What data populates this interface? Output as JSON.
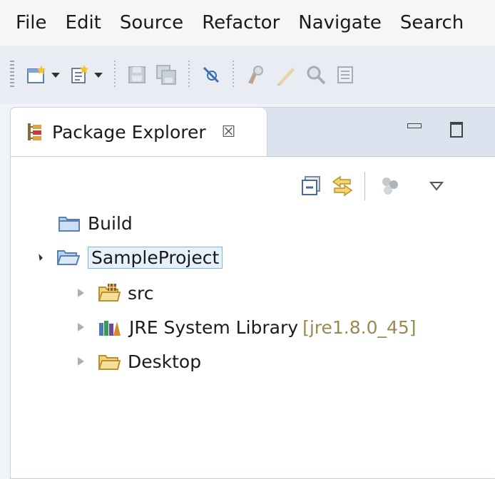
{
  "menu": {
    "items": [
      "File",
      "Edit",
      "Source",
      "Refactor",
      "Navigate",
      "Search"
    ]
  },
  "toolbar": {
    "buttons": [
      {
        "icon": "new-wizard-icon",
        "has_dropdown": true
      },
      {
        "icon": "new-java-icon",
        "has_dropdown": true
      },
      {
        "icon": "save-icon",
        "has_dropdown": false
      },
      {
        "icon": "save-all-icon",
        "has_dropdown": false
      },
      {
        "icon": "skip-breakpoints-icon",
        "has_dropdown": false
      },
      {
        "icon": "mark-occurrences-icon",
        "has_dropdown": false
      },
      {
        "icon": "toggle-edit-icon",
        "has_dropdown": false
      },
      {
        "icon": "search-icon",
        "has_dropdown": false
      },
      {
        "icon": "block-selection-icon",
        "has_dropdown": false
      }
    ]
  },
  "view": {
    "tab_label": "Package Explorer",
    "close_glyph": "☒",
    "view_toolbar": [
      "collapse-all-icon",
      "link-with-editor-icon",
      "filters-icon",
      "view-menu-icon"
    ]
  },
  "tree": {
    "items": [
      {
        "label": "Build",
        "icon": "project-closed-icon",
        "level": 0,
        "expanded": null
      },
      {
        "label": "SampleProject",
        "icon": "project-open-icon",
        "level": 0,
        "expanded": true,
        "selected": true
      },
      {
        "label": "src",
        "icon": "source-folder-icon",
        "level": 1,
        "expanded": false
      },
      {
        "label": "JRE System Library",
        "decoration": "[jre1.8.0_45]",
        "icon": "library-icon",
        "level": 1,
        "expanded": false
      },
      {
        "label": "Desktop",
        "icon": "folder-icon",
        "level": 1,
        "expanded": false
      }
    ]
  },
  "colors": {
    "selection_border": "#7fb5e8",
    "selection_fill": "#e6f1fb",
    "decoration_text": "#9a8a50",
    "folder_yellow": "#e8c25a"
  }
}
